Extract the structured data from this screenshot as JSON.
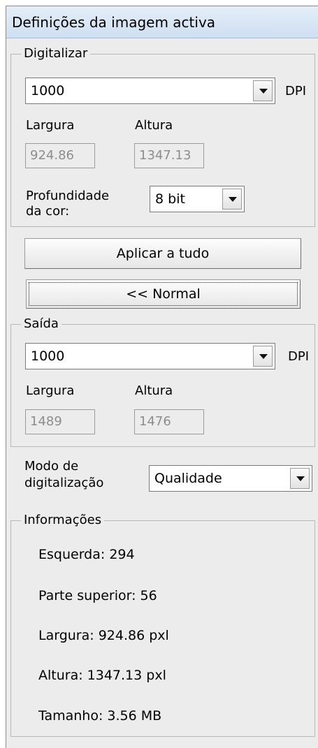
{
  "panel": {
    "title": "Definições da imagem activa"
  },
  "scan": {
    "legend": "Digitalizar",
    "dpi_value": "1000",
    "dpi_unit": "DPI",
    "width_label": "Largura",
    "height_label": "Altura",
    "width_value": "924.86",
    "height_value": "1347.13",
    "depth_label_line1": "Profundidade",
    "depth_label_line2": "da cor:",
    "depth_value": "8 bit"
  },
  "buttons": {
    "apply_all": "Aplicar a tudo",
    "normal": "<< Normal"
  },
  "output": {
    "legend": "Saída",
    "dpi_value": "1000",
    "dpi_unit": "DPI",
    "width_label": "Largura",
    "height_label": "Altura",
    "width_value": "1489",
    "height_value": "1476"
  },
  "scan_mode": {
    "label_line1": "Modo de",
    "label_line2": "digitalização",
    "value": "Qualidade"
  },
  "info": {
    "legend": "Informações",
    "left": "Esquerda: 294",
    "top": "Parte superior: 56",
    "width": "Largura: 924.86 pxl",
    "height": "Altura: 1347.13 pxl",
    "size": "Tamanho: 3.56 MB"
  }
}
